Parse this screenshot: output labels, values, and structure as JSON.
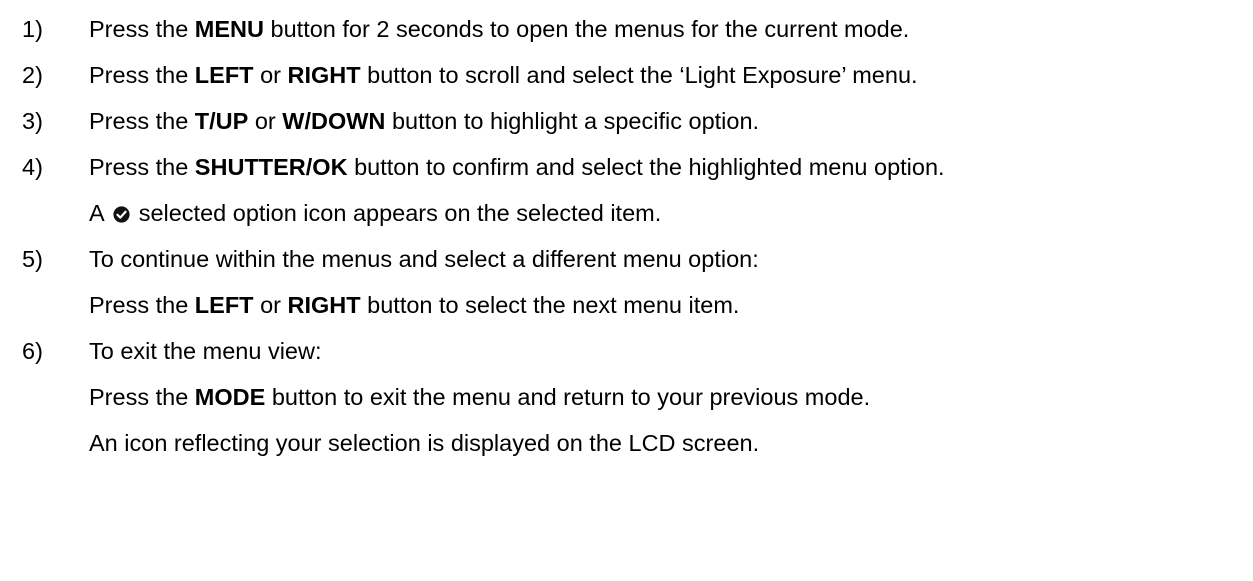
{
  "steps": [
    {
      "num": "1)",
      "lines": [
        [
          "Press the ",
          {
            "b": "MENU"
          },
          " button for 2 seconds to open the menus for the current mode."
        ]
      ]
    },
    {
      "num": "2)",
      "lines": [
        [
          "Press the ",
          {
            "b": "LEFT"
          },
          " or ",
          {
            "b": "RIGHT"
          },
          " button to scroll and select the ‘Light Exposure’ menu."
        ]
      ]
    },
    {
      "num": "3)",
      "lines": [
        [
          "Press the ",
          {
            "b": "T/UP"
          },
          " or ",
          {
            "b": "W/DOWN"
          },
          " button to highlight a specific option."
        ]
      ]
    },
    {
      "num": "4)",
      "lines": [
        [
          "Press the ",
          {
            "b": "SHUTTER/OK"
          },
          " button to confirm and select the highlighted menu option."
        ],
        [
          "A",
          {
            "icon": "selected-option-check-icon"
          },
          "selected option icon appears on the selected item."
        ]
      ]
    },
    {
      "num": "5)",
      "lines": [
        [
          "To continue within the menus and select a different menu option:"
        ],
        [
          "Press the ",
          {
            "b": "LEFT"
          },
          " or ",
          {
            "b": "RIGHT"
          },
          " button to select the next menu item."
        ]
      ]
    },
    {
      "num": "6)",
      "lines": [
        [
          "To exit the menu view:"
        ],
        [
          "Press the ",
          {
            "b": "MODE"
          },
          " button to exit the menu and return to your previous mode."
        ],
        [
          "An icon reflecting your selection is displayed on the LCD screen."
        ]
      ]
    }
  ]
}
